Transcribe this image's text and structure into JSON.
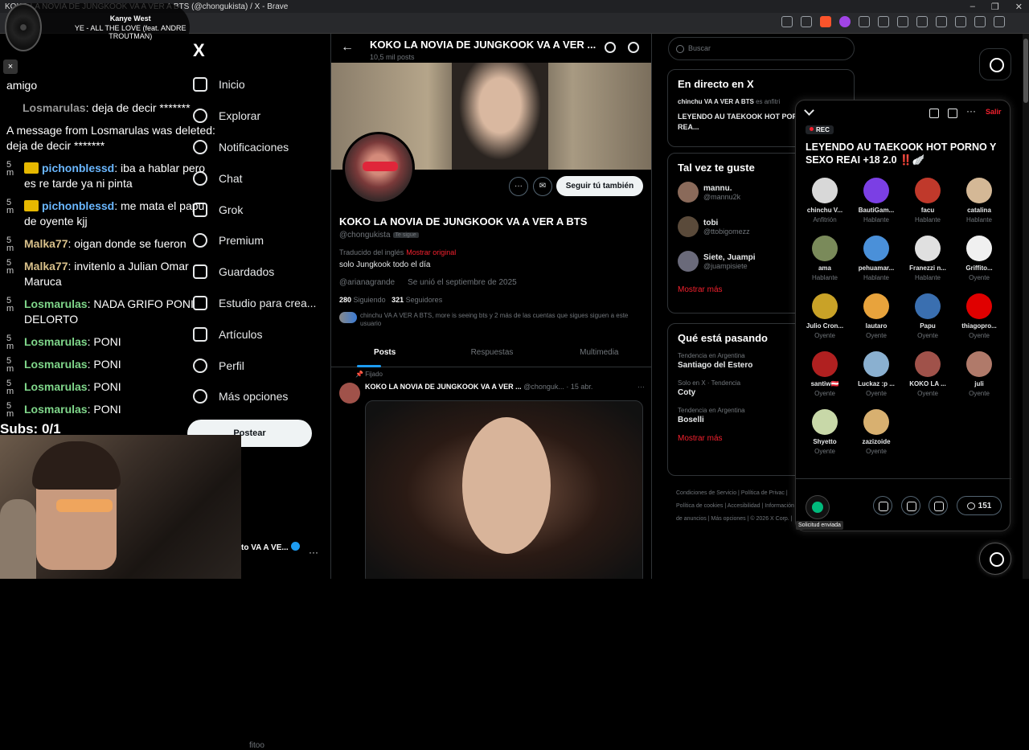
{
  "browser": {
    "title": "KOKO LA NOVIA DE JUNGKOOK VA A VER A BTS (@chongukista) / X - Brave"
  },
  "overlay": {
    "now_playing": {
      "artist": "Kanye West",
      "track": "YE - ALL THE LOVE (feat. ANDRE TROUTMAN)"
    },
    "close_label": "×",
    "subs": "Subs: 0/1",
    "chat": [
      {
        "time": "",
        "user": "",
        "text": "amigo",
        "color": "",
        "crown": false
      },
      {
        "time": "",
        "user": "Losmarulas",
        "text": ": deja de decir *******",
        "color": "gray",
        "crown": false
      },
      {
        "time": "",
        "user": "",
        "text": "A message from Losmarulas was deleted: deja de decir *******",
        "color": "",
        "crown": false
      },
      {
        "time": "5 m",
        "user": "pichonblessd",
        "text": ": iba a hablar pero es re tarde ya ni pinta",
        "color": "blue",
        "crown": true
      },
      {
        "time": "5 m",
        "user": "pichonblessd",
        "text": ": me mata el papu de oyente kjj",
        "color": "blue",
        "crown": true
      },
      {
        "time": "5 m",
        "user": "Malka77",
        "text": ": oigan donde se fueron",
        "color": "tan",
        "crown": false
      },
      {
        "time": "5 m",
        "user": "Malka77",
        "text": ": invitenlo a Julian Omar Maruca",
        "color": "tan",
        "crown": false
      },
      {
        "time": "5 m",
        "user": "Losmarulas",
        "text": ": NADA GRIFO PONI DELORTO",
        "color": "green",
        "crown": false
      },
      {
        "time": "5 m",
        "user": "Losmarulas",
        "text": ": PONI",
        "color": "green",
        "crown": false
      },
      {
        "time": "5 m",
        "user": "Losmarulas",
        "text": ": PONI",
        "color": "green",
        "crown": false
      },
      {
        "time": "5 m",
        "user": "Losmarulas",
        "text": ": PONI",
        "color": "green",
        "crown": false
      },
      {
        "time": "5 m",
        "user": "Losmarulas",
        "text": ": PONI",
        "color": "green",
        "crown": false
      }
    ]
  },
  "nav": {
    "logo": "X",
    "items": [
      "Inicio",
      "Explorar",
      "Notificaciones",
      "Chat",
      "Grok",
      "Premium",
      "Guardados",
      "Estudio para crea...",
      "Artículos",
      "Perfil",
      "Más opciones"
    ],
    "post_button": "Postear",
    "account_name": "to VA A VE...",
    "account_handle": "fitoo"
  },
  "profile": {
    "header_name": "KOKO LA NOVIA DE JUNGKOOK VA A VER ...",
    "posts_count": "10,5 mil posts",
    "follow_button": "Seguir tú también",
    "more_label": "···",
    "display_name": "KOKO LA NOVIA DE JUNGKOOK VA A VER A BTS",
    "handle": "@chongukista",
    "follows_you": "Te sigue",
    "translated": "Traducido del inglés",
    "show_original": "Mostrar original",
    "bio": "solo Jungkook todo el día",
    "link": "@arianagrande",
    "joined": "Se unió el septiembre de 2025",
    "following_count": "280",
    "following_label": "Siguiendo",
    "followers_count": "321",
    "followers_label": "Seguidores",
    "known_followers": "chinchu VA A VER A BTS, more is seeing bts y 2 más de las cuentas que sigues siguen a este usuario",
    "tabs": [
      "Posts",
      "Respuestas",
      "Multimedia"
    ],
    "pinned": "Fijado",
    "tweet_name": "KOKO LA NOVIA DE JUNGKOOK VA A VER ...",
    "tweet_handle": "@chonguk...",
    "tweet_date": "· 15 abr."
  },
  "sidebar": {
    "search_placeholder": "Buscar",
    "live": {
      "title": "En directo en X",
      "host": "chinchu VA A VER A BTS",
      "host_suffix": "es anfitri",
      "space_title": "LEYENDO AU TAEKOOK HOT PORNO Y SEXO REA..."
    },
    "suggestions": {
      "title": "Tal vez te guste",
      "users": [
        {
          "name": "mannu.",
          "handle": "@mannu2k"
        },
        {
          "name": "tobi",
          "handle": "@ttobigomezz"
        },
        {
          "name": "Siete, Juampi",
          "handle": "@juampisiete"
        }
      ],
      "more": "Mostrar más"
    },
    "trends": {
      "title": "Qué está pasando",
      "items": [
        {
          "category": "Tendencia en Argentina",
          "name": "Santiago del Estero"
        },
        {
          "category": "Solo en X · Tendencia",
          "name": "Coty"
        },
        {
          "category": "Tendencia en Argentina",
          "name": "Boselli"
        }
      ],
      "more": "Mostrar más"
    },
    "footer": [
      "Condiciones de Servicio",
      "Política de Privac",
      "Política de cookies",
      "Accesibilidad",
      "Información de anuncios",
      "Más opciones",
      "© 2026 X Corp."
    ]
  },
  "space": {
    "leave": "Salir",
    "rec": "REC",
    "title": "LEYENDO AU TAEKOOK HOT PORNO Y SEXO REAI +18 2.0 ‼️🪽",
    "participants": [
      {
        "name": "chinchu V...",
        "role": "Anfitrión",
        "color": "#d8d8d8"
      },
      {
        "name": "BautiGam...",
        "role": "Hablante",
        "color": "#7b3fe4"
      },
      {
        "name": "facu",
        "role": "Hablante",
        "color": "#c0392b"
      },
      {
        "name": "catalina",
        "role": "Hablante",
        "color": "#d4b896"
      },
      {
        "name": "ama",
        "role": "Hablante",
        "color": "#7a8a5a"
      },
      {
        "name": "pehuamar...",
        "role": "Hablante",
        "color": "#4a90d9"
      },
      {
        "name": "Franezzi n...",
        "role": "Hablante",
        "color": "#e0e0e0"
      },
      {
        "name": "Griffito...",
        "role": "Oyente",
        "color": "#f0f0f0"
      },
      {
        "name": "Julio Cron...",
        "role": "Oyente",
        "color": "#c9a227"
      },
      {
        "name": "lautaro",
        "role": "Oyente",
        "color": "#e8a33c"
      },
      {
        "name": "Papu",
        "role": "Oyente",
        "color": "#3a6fb0"
      },
      {
        "name": "thiagopro...",
        "role": "Oyente",
        "color": "#e00000"
      },
      {
        "name": "santiw🇦🇹",
        "role": "Oyente",
        "color": "#b02020"
      },
      {
        "name": "Luckaz :p ...",
        "role": "Oyente",
        "color": "#8ab0d0"
      },
      {
        "name": "KOKO LA ...",
        "role": "Oyente",
        "color": "#a0524a"
      },
      {
        "name": "juli",
        "role": "Oyente",
        "color": "#b07a6a"
      },
      {
        "name": "Shyetto",
        "role": "Oyente",
        "color": "#c8d8a8"
      },
      {
        "name": "zazizoide",
        "role": "Oyente",
        "color": "#d8b070"
      }
    ],
    "request_sent": "Solicitud enviada",
    "comments": "151"
  }
}
